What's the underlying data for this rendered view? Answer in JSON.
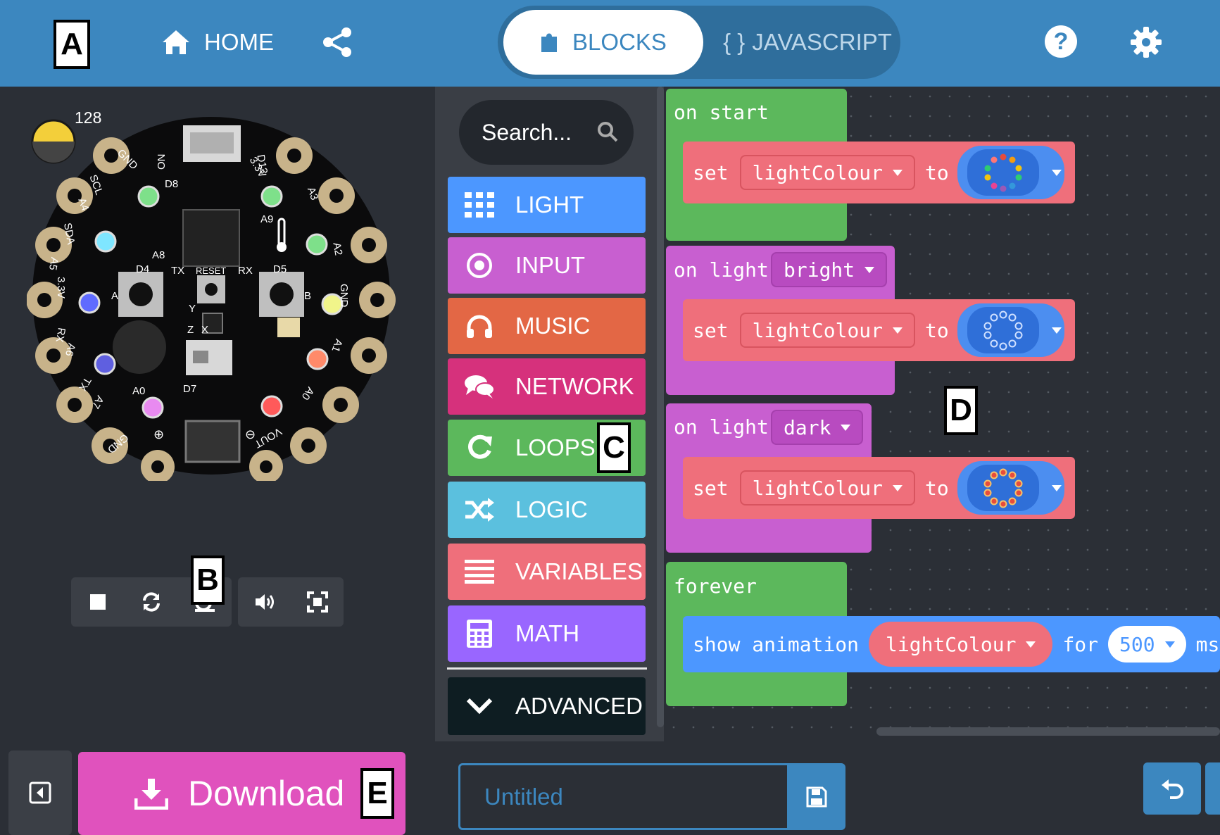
{
  "header": {
    "callout_a": "A",
    "home_label": "HOME",
    "tab_blocks": "BLOCKS",
    "tab_javascript": "JAVASCRIPT",
    "tab_javascript_icon": "{ }",
    "help_label": "?"
  },
  "simulator": {
    "light_level": "128",
    "callout_b": "B",
    "pins_left": [
      "GND",
      "SCL",
      "A4",
      "SDA",
      "A5",
      "3.3V",
      "RX",
      "A6",
      "TX",
      "A7",
      "GND"
    ],
    "pins_right": [
      "3.3V",
      "A3",
      "A2",
      "GND",
      "A1",
      "A0",
      "VOUT"
    ],
    "board_labels": {
      "on": "ON",
      "d13": "D13",
      "d8": "D8",
      "a9": "A9",
      "a8": "A8",
      "d4": "D4",
      "tx": "TX",
      "reset": "RESET",
      "rx": "RX",
      "d5": "D5",
      "btn_a": "A",
      "btn_b": "B",
      "a0": "A0",
      "d7": "D7",
      "y": "Y",
      "x": "X",
      "z": "Z",
      "plus": "⊕",
      "minus": "⊖"
    },
    "controls": [
      "stop-icon",
      "restart-icon",
      "slow-motion-icon",
      "sound-icon",
      "fullscreen-icon"
    ],
    "colors": {
      "board": "#0b0b0c",
      "pad": "#c8b38a",
      "light_sensor": "#f3cf3a"
    }
  },
  "toolbox": {
    "search_placeholder": "Search...",
    "callout_c": "C",
    "categories": [
      {
        "label": "LIGHT",
        "color": "#4c97ff",
        "icon": "grid-icon"
      },
      {
        "label": "INPUT",
        "color": "#c85fd0",
        "icon": "target-icon"
      },
      {
        "label": "MUSIC",
        "color": "#e36745",
        "icon": "headphones-icon"
      },
      {
        "label": "NETWORK",
        "color": "#d6317c",
        "icon": "chat-icon"
      },
      {
        "label": "LOOPS",
        "color": "#5cb85c",
        "icon": "loop-icon"
      },
      {
        "label": "LOGIC",
        "color": "#5bc0de",
        "icon": "shuffle-icon"
      },
      {
        "label": "VARIABLES",
        "color": "#ef6f7b",
        "icon": "list-icon"
      },
      {
        "label": "MATH",
        "color": "#9966ff",
        "icon": "calculator-icon"
      }
    ],
    "advanced_label": "ADVANCED"
  },
  "workspace": {
    "callout_d": "D",
    "on_start": {
      "label": "on start",
      "set": "set",
      "variable": "lightColour",
      "to": "to",
      "ring_colors": [
        "#e74c3c",
        "#f39c12",
        "#f1c40f",
        "#2ecc71",
        "#3498db",
        "#9b59b6",
        "#e84393",
        "#1abc9c",
        "#ff7675",
        "#00cec9"
      ]
    },
    "on_light_bright": {
      "label": "on light",
      "option": "bright",
      "set": "set",
      "variable": "lightColour",
      "to": "to"
    },
    "on_light_dark": {
      "label": "on light",
      "option": "dark",
      "set": "set",
      "variable": "lightColour",
      "to": "to"
    },
    "forever": {
      "label": "forever",
      "show_animation": "show animation",
      "variable": "lightColour",
      "for": "for",
      "duration": "500",
      "unit": "ms"
    },
    "colors": {
      "event": "#5cb85c",
      "input": "#c85fd0",
      "variables": "#ef6f7b",
      "light": "#4c97ff"
    }
  },
  "bottom": {
    "download_label": "Download",
    "callout_e": "E",
    "project_name_placeholder": "Untitled"
  }
}
